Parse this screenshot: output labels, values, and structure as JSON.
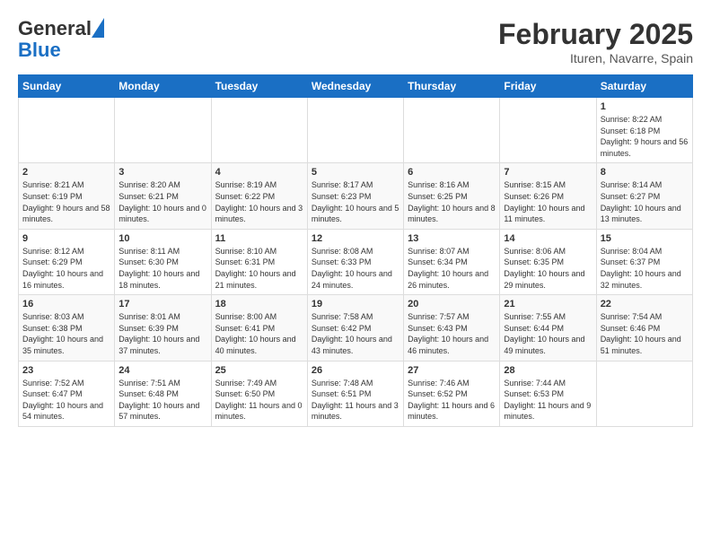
{
  "logo": {
    "line1": "General",
    "line2": "Blue"
  },
  "title": "February 2025",
  "subtitle": "Ituren, Navarre, Spain",
  "days_of_week": [
    "Sunday",
    "Monday",
    "Tuesday",
    "Wednesday",
    "Thursday",
    "Friday",
    "Saturday"
  ],
  "weeks": [
    [
      {
        "day": "",
        "info": ""
      },
      {
        "day": "",
        "info": ""
      },
      {
        "day": "",
        "info": ""
      },
      {
        "day": "",
        "info": ""
      },
      {
        "day": "",
        "info": ""
      },
      {
        "day": "",
        "info": ""
      },
      {
        "day": "1",
        "info": "Sunrise: 8:22 AM\nSunset: 6:18 PM\nDaylight: 9 hours and 56 minutes."
      }
    ],
    [
      {
        "day": "2",
        "info": "Sunrise: 8:21 AM\nSunset: 6:19 PM\nDaylight: 9 hours and 58 minutes."
      },
      {
        "day": "3",
        "info": "Sunrise: 8:20 AM\nSunset: 6:21 PM\nDaylight: 10 hours and 0 minutes."
      },
      {
        "day": "4",
        "info": "Sunrise: 8:19 AM\nSunset: 6:22 PM\nDaylight: 10 hours and 3 minutes."
      },
      {
        "day": "5",
        "info": "Sunrise: 8:17 AM\nSunset: 6:23 PM\nDaylight: 10 hours and 5 minutes."
      },
      {
        "day": "6",
        "info": "Sunrise: 8:16 AM\nSunset: 6:25 PM\nDaylight: 10 hours and 8 minutes."
      },
      {
        "day": "7",
        "info": "Sunrise: 8:15 AM\nSunset: 6:26 PM\nDaylight: 10 hours and 11 minutes."
      },
      {
        "day": "8",
        "info": "Sunrise: 8:14 AM\nSunset: 6:27 PM\nDaylight: 10 hours and 13 minutes."
      }
    ],
    [
      {
        "day": "9",
        "info": "Sunrise: 8:12 AM\nSunset: 6:29 PM\nDaylight: 10 hours and 16 minutes."
      },
      {
        "day": "10",
        "info": "Sunrise: 8:11 AM\nSunset: 6:30 PM\nDaylight: 10 hours and 18 minutes."
      },
      {
        "day": "11",
        "info": "Sunrise: 8:10 AM\nSunset: 6:31 PM\nDaylight: 10 hours and 21 minutes."
      },
      {
        "day": "12",
        "info": "Sunrise: 8:08 AM\nSunset: 6:33 PM\nDaylight: 10 hours and 24 minutes."
      },
      {
        "day": "13",
        "info": "Sunrise: 8:07 AM\nSunset: 6:34 PM\nDaylight: 10 hours and 26 minutes."
      },
      {
        "day": "14",
        "info": "Sunrise: 8:06 AM\nSunset: 6:35 PM\nDaylight: 10 hours and 29 minutes."
      },
      {
        "day": "15",
        "info": "Sunrise: 8:04 AM\nSunset: 6:37 PM\nDaylight: 10 hours and 32 minutes."
      }
    ],
    [
      {
        "day": "16",
        "info": "Sunrise: 8:03 AM\nSunset: 6:38 PM\nDaylight: 10 hours and 35 minutes."
      },
      {
        "day": "17",
        "info": "Sunrise: 8:01 AM\nSunset: 6:39 PM\nDaylight: 10 hours and 37 minutes."
      },
      {
        "day": "18",
        "info": "Sunrise: 8:00 AM\nSunset: 6:41 PM\nDaylight: 10 hours and 40 minutes."
      },
      {
        "day": "19",
        "info": "Sunrise: 7:58 AM\nSunset: 6:42 PM\nDaylight: 10 hours and 43 minutes."
      },
      {
        "day": "20",
        "info": "Sunrise: 7:57 AM\nSunset: 6:43 PM\nDaylight: 10 hours and 46 minutes."
      },
      {
        "day": "21",
        "info": "Sunrise: 7:55 AM\nSunset: 6:44 PM\nDaylight: 10 hours and 49 minutes."
      },
      {
        "day": "22",
        "info": "Sunrise: 7:54 AM\nSunset: 6:46 PM\nDaylight: 10 hours and 51 minutes."
      }
    ],
    [
      {
        "day": "23",
        "info": "Sunrise: 7:52 AM\nSunset: 6:47 PM\nDaylight: 10 hours and 54 minutes."
      },
      {
        "day": "24",
        "info": "Sunrise: 7:51 AM\nSunset: 6:48 PM\nDaylight: 10 hours and 57 minutes."
      },
      {
        "day": "25",
        "info": "Sunrise: 7:49 AM\nSunset: 6:50 PM\nDaylight: 11 hours and 0 minutes."
      },
      {
        "day": "26",
        "info": "Sunrise: 7:48 AM\nSunset: 6:51 PM\nDaylight: 11 hours and 3 minutes."
      },
      {
        "day": "27",
        "info": "Sunrise: 7:46 AM\nSunset: 6:52 PM\nDaylight: 11 hours and 6 minutes."
      },
      {
        "day": "28",
        "info": "Sunrise: 7:44 AM\nSunset: 6:53 PM\nDaylight: 11 hours and 9 minutes."
      },
      {
        "day": "",
        "info": ""
      }
    ]
  ]
}
